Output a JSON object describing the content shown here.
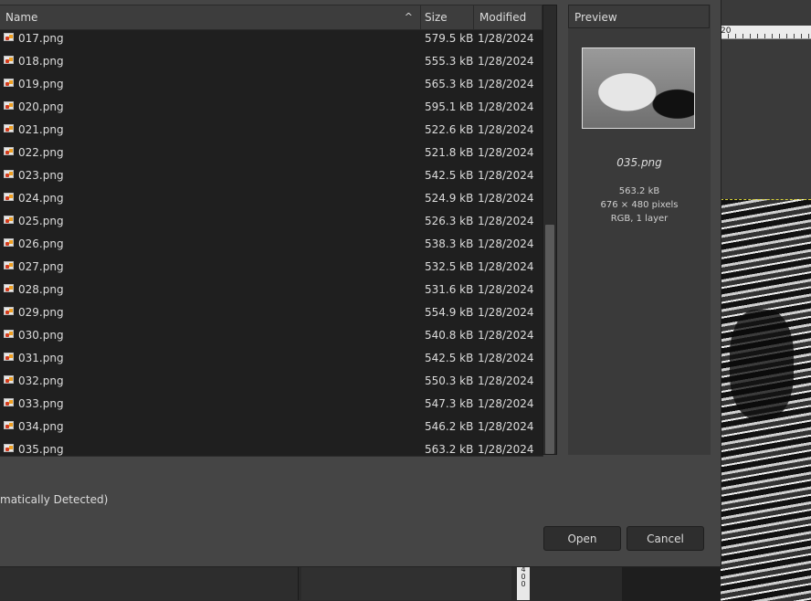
{
  "background": {
    "ruler_label": "20",
    "vruler_label": "4\n0\n0"
  },
  "file_list": {
    "columns": {
      "name": "Name",
      "size": "Size",
      "modified": "Modified"
    },
    "sort_indicator": "^",
    "rows": [
      {
        "name": "017.png",
        "size": "579.5 kB",
        "modified": "1/28/2024"
      },
      {
        "name": "018.png",
        "size": "555.3 kB",
        "modified": "1/28/2024"
      },
      {
        "name": "019.png",
        "size": "565.3 kB",
        "modified": "1/28/2024"
      },
      {
        "name": "020.png",
        "size": "595.1 kB",
        "modified": "1/28/2024"
      },
      {
        "name": "021.png",
        "size": "522.6 kB",
        "modified": "1/28/2024"
      },
      {
        "name": "022.png",
        "size": "521.8 kB",
        "modified": "1/28/2024"
      },
      {
        "name": "023.png",
        "size": "542.5 kB",
        "modified": "1/28/2024"
      },
      {
        "name": "024.png",
        "size": "524.9 kB",
        "modified": "1/28/2024"
      },
      {
        "name": "025.png",
        "size": "526.3 kB",
        "modified": "1/28/2024"
      },
      {
        "name": "026.png",
        "size": "538.3 kB",
        "modified": "1/28/2024"
      },
      {
        "name": "027.png",
        "size": "532.5 kB",
        "modified": "1/28/2024"
      },
      {
        "name": "028.png",
        "size": "531.6 kB",
        "modified": "1/28/2024"
      },
      {
        "name": "029.png",
        "size": "554.9 kB",
        "modified": "1/28/2024"
      },
      {
        "name": "030.png",
        "size": "540.8 kB",
        "modified": "1/28/2024"
      },
      {
        "name": "031.png",
        "size": "542.5 kB",
        "modified": "1/28/2024"
      },
      {
        "name": "032.png",
        "size": "550.3 kB",
        "modified": "1/28/2024"
      },
      {
        "name": "033.png",
        "size": "547.3 kB",
        "modified": "1/28/2024"
      },
      {
        "name": "034.png",
        "size": "546.2 kB",
        "modified": "1/28/2024"
      },
      {
        "name": "035.png",
        "size": "563.2 kB",
        "modified": "1/28/2024"
      }
    ]
  },
  "preview": {
    "title": "Preview",
    "filename": "035.png",
    "size": "563.2 kB",
    "dimensions": "676 × 480 pixels",
    "color": "RGB, 1 layer"
  },
  "file_type_filter": "matically Detected)",
  "buttons": {
    "open": "Open",
    "cancel": "Cancel"
  },
  "colors": {
    "dialog_bg": "#454545",
    "list_bg": "#1f1f1f",
    "text": "#dcdcdc"
  }
}
